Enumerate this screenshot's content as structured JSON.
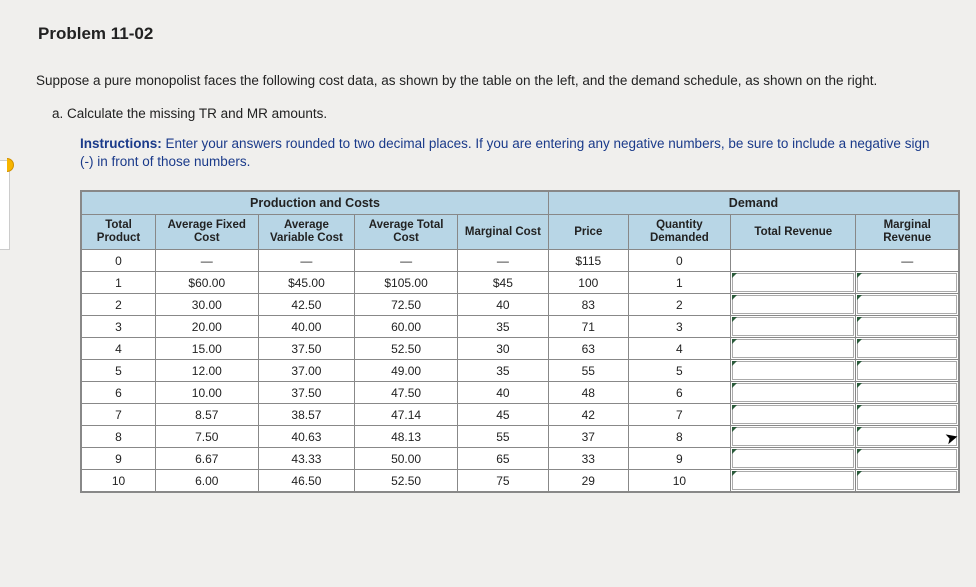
{
  "title": "Problem 11-02",
  "intro": "Suppose a pure monopolist faces the following cost data, as shown by the table on the left, and the demand schedule, as shown on the right.",
  "part_a": "a. Calculate the missing TR and MR amounts.",
  "instructions_label": "Instructions:",
  "instructions_text": " Enter your answers rounded to two decimal places. If you are entering any negative numbers, be sure to include a negative sign (-) in front of those numbers.",
  "group_headers": {
    "left": "Production and Costs",
    "right": "Demand"
  },
  "col_headers": {
    "tp": "Total Product",
    "afc": "Average Fixed Cost",
    "avc": "Average Variable Cost",
    "atc": "Average Total Cost",
    "mc": "Marginal Cost",
    "price": "Price",
    "qd": "Quantity Demanded",
    "tr": "Total Revenue",
    "mr": "Marginal Revenue"
  },
  "chart_data": {
    "type": "table",
    "rows": [
      {
        "tp": "0",
        "afc": "—",
        "avc": "—",
        "atc": "—",
        "mc": "—",
        "price": "$115",
        "qd": "0",
        "tr_input": false,
        "mr_dash": true
      },
      {
        "tp": "1",
        "afc": "$60.00",
        "avc": "$45.00",
        "atc": "$105.00",
        "mc": "$45",
        "price": "100",
        "qd": "1",
        "tr_input": true,
        "mr_input": true
      },
      {
        "tp": "2",
        "afc": "30.00",
        "avc": "42.50",
        "atc": "72.50",
        "mc": "40",
        "price": "83",
        "qd": "2",
        "tr_input": true,
        "mr_input": true
      },
      {
        "tp": "3",
        "afc": "20.00",
        "avc": "40.00",
        "atc": "60.00",
        "mc": "35",
        "price": "71",
        "qd": "3",
        "tr_input": true,
        "mr_input": true
      },
      {
        "tp": "4",
        "afc": "15.00",
        "avc": "37.50",
        "atc": "52.50",
        "mc": "30",
        "price": "63",
        "qd": "4",
        "tr_input": true,
        "mr_input": true
      },
      {
        "tp": "5",
        "afc": "12.00",
        "avc": "37.00",
        "atc": "49.00",
        "mc": "35",
        "price": "55",
        "qd": "5",
        "tr_input": true,
        "mr_input": true
      },
      {
        "tp": "6",
        "afc": "10.00",
        "avc": "37.50",
        "atc": "47.50",
        "mc": "40",
        "price": "48",
        "qd": "6",
        "tr_input": true,
        "mr_input": true
      },
      {
        "tp": "7",
        "afc": "8.57",
        "avc": "38.57",
        "atc": "47.14",
        "mc": "45",
        "price": "42",
        "qd": "7",
        "tr_input": true,
        "mr_input": true
      },
      {
        "tp": "8",
        "afc": "7.50",
        "avc": "40.63",
        "atc": "48.13",
        "mc": "55",
        "price": "37",
        "qd": "8",
        "tr_input": true,
        "mr_input": true
      },
      {
        "tp": "9",
        "afc": "6.67",
        "avc": "43.33",
        "atc": "50.00",
        "mc": "65",
        "price": "33",
        "qd": "9",
        "tr_input": true,
        "mr_input": true
      },
      {
        "tp": "10",
        "afc": "6.00",
        "avc": "46.50",
        "atc": "52.50",
        "mc": "75",
        "price": "29",
        "qd": "10",
        "tr_input": true,
        "mr_input": true
      }
    ]
  }
}
